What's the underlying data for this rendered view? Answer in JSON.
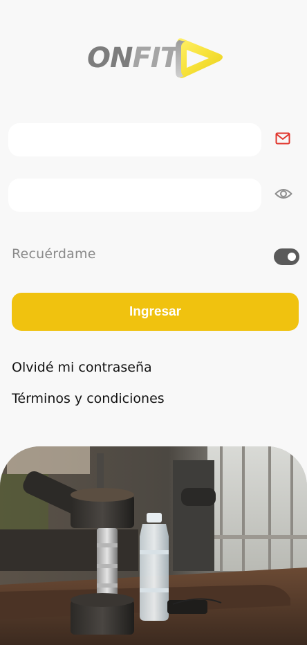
{
  "brand": {
    "word_on": "ON",
    "word_fit": "FIT"
  },
  "form": {
    "email_placeholder": "",
    "password_placeholder": "",
    "email_icon": "mail-icon",
    "password_icon": "eye-icon"
  },
  "remember": {
    "label": "Recuérdame",
    "enabled": true
  },
  "buttons": {
    "login_label": "Ingresar"
  },
  "links": {
    "forgot_password": "Olvidé mi contraseña",
    "terms": "Términos y condiciones"
  },
  "colors": {
    "accent": "#f0c20f",
    "mail_icon": "#e0342b",
    "toggle_track": "#5a5a5a",
    "background": "#f8f8f8"
  },
  "hero_image": {
    "subject": "gym-dumbbell-water-bottle"
  }
}
